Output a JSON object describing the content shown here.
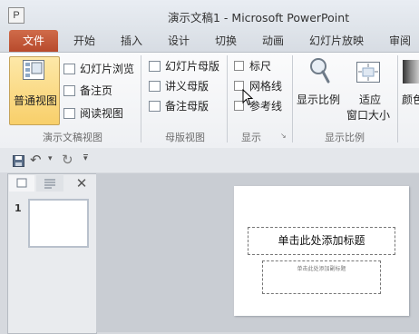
{
  "titlebar": {
    "app_icon_letter": "P",
    "title": "演示文稿1 - Microsoft PowerPoint"
  },
  "tabs": [
    {
      "label": "文件"
    },
    {
      "label": "开始"
    },
    {
      "label": "插入"
    },
    {
      "label": "设计"
    },
    {
      "label": "切换"
    },
    {
      "label": "动画"
    },
    {
      "label": "幻灯片放映"
    },
    {
      "label": "审阅"
    }
  ],
  "ribbon": {
    "presentation_views": {
      "normal": "普通视图",
      "slide_sorter": "幻灯片浏览",
      "notes_page": "备注页",
      "reading_view": "阅读视图",
      "group_label": "演示文稿视图"
    },
    "master_views": {
      "slide_master": "幻灯片母版",
      "handout_master": "讲义母版",
      "notes_master": "备注母版",
      "group_label": "母版视图"
    },
    "show": {
      "ruler": "标尺",
      "gridlines": "网格线",
      "guides": "参考线",
      "group_label": "显示",
      "launcher": "↘"
    },
    "zoom": {
      "zoom": "显示比例",
      "fit_line1": "适应",
      "fit_line2": "窗口大小",
      "group_label": "显示比例"
    },
    "color_partial": "颜色"
  },
  "qat": {
    "save": "save",
    "undo_arrow": "↶",
    "dropdown": "▾",
    "redo_arrow": "↻",
    "customize": "▾"
  },
  "left_pane": {
    "close": "✕",
    "thumbnail_number": "1"
  },
  "slide": {
    "title_placeholder": "单击此处添加标题",
    "subtitle_placeholder": "单击此处添加副标题"
  }
}
